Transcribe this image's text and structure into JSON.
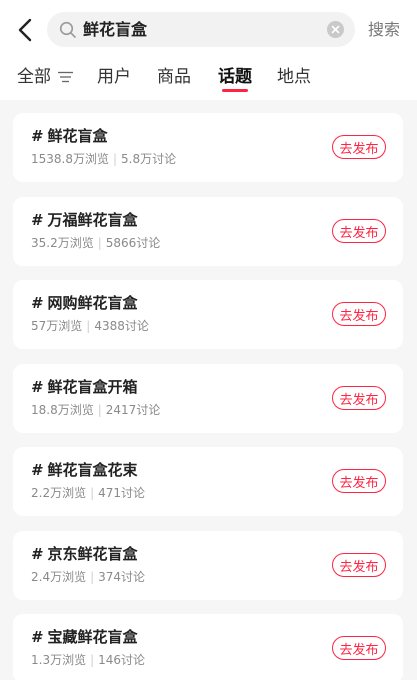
{
  "search": {
    "value": "鲜花盲盒",
    "action_label": "搜索"
  },
  "tabs": [
    {
      "label": "全部"
    },
    {
      "label": "用户"
    },
    {
      "label": "商品"
    },
    {
      "label": "话题"
    },
    {
      "label": "地点"
    }
  ],
  "active_tab": "话题",
  "topics": [
    {
      "title": "鲜花盲盒",
      "views": "1538.8万浏览",
      "discussions": "5.8万讨论",
      "button": "去发布"
    },
    {
      "title": "万福鲜花盲盒",
      "views": "35.2万浏览",
      "discussions": "5866讨论",
      "button": "去发布"
    },
    {
      "title": "网购鲜花盲盒",
      "views": "57万浏览",
      "discussions": "4388讨论",
      "button": "去发布"
    },
    {
      "title": "鲜花盲盒开箱",
      "views": "18.8万浏览",
      "discussions": "2417讨论",
      "button": "去发布"
    },
    {
      "title": "鲜花盲盒花束",
      "views": "2.2万浏览",
      "discussions": "471讨论",
      "button": "去发布"
    },
    {
      "title": "京东鲜花盲盒",
      "views": "2.4万浏览",
      "discussions": "374讨论",
      "button": "去发布"
    },
    {
      "title": "宝藏鲜花盲盒",
      "views": "1.3万浏览",
      "discussions": "146讨论",
      "button": "去发布"
    }
  ],
  "colors": {
    "accent": "#ff2442",
    "page_bg": "#f6f6f6",
    "card_bg": "#ffffff",
    "meta_text": "#8a8a8a"
  },
  "icons": {
    "back": "chevron-left-icon",
    "search": "search-icon",
    "clear": "clear-icon",
    "filter": "filter-icon",
    "topic": "hash-icon"
  }
}
